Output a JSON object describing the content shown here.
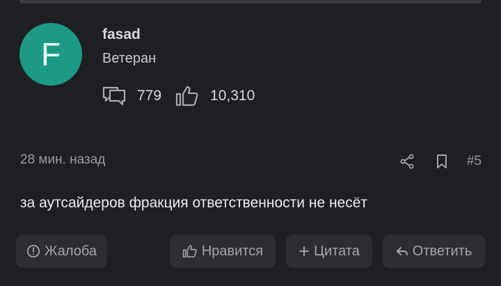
{
  "user": {
    "avatar_letter": "F",
    "name": "fasad",
    "rank": "Ветеран",
    "messages": "779",
    "likes": "10,310"
  },
  "post": {
    "time": "28 мин. назад",
    "number": "#5",
    "text": "за аутсайдеров фракция ответственности не несёт"
  },
  "actions": {
    "report": "Жалоба",
    "like": "Нравится",
    "quote": "Цитата",
    "reply": "Ответить"
  },
  "colors": {
    "background": "#1e1f23",
    "avatar": "#1d9a86",
    "button": "#2d2e33"
  }
}
